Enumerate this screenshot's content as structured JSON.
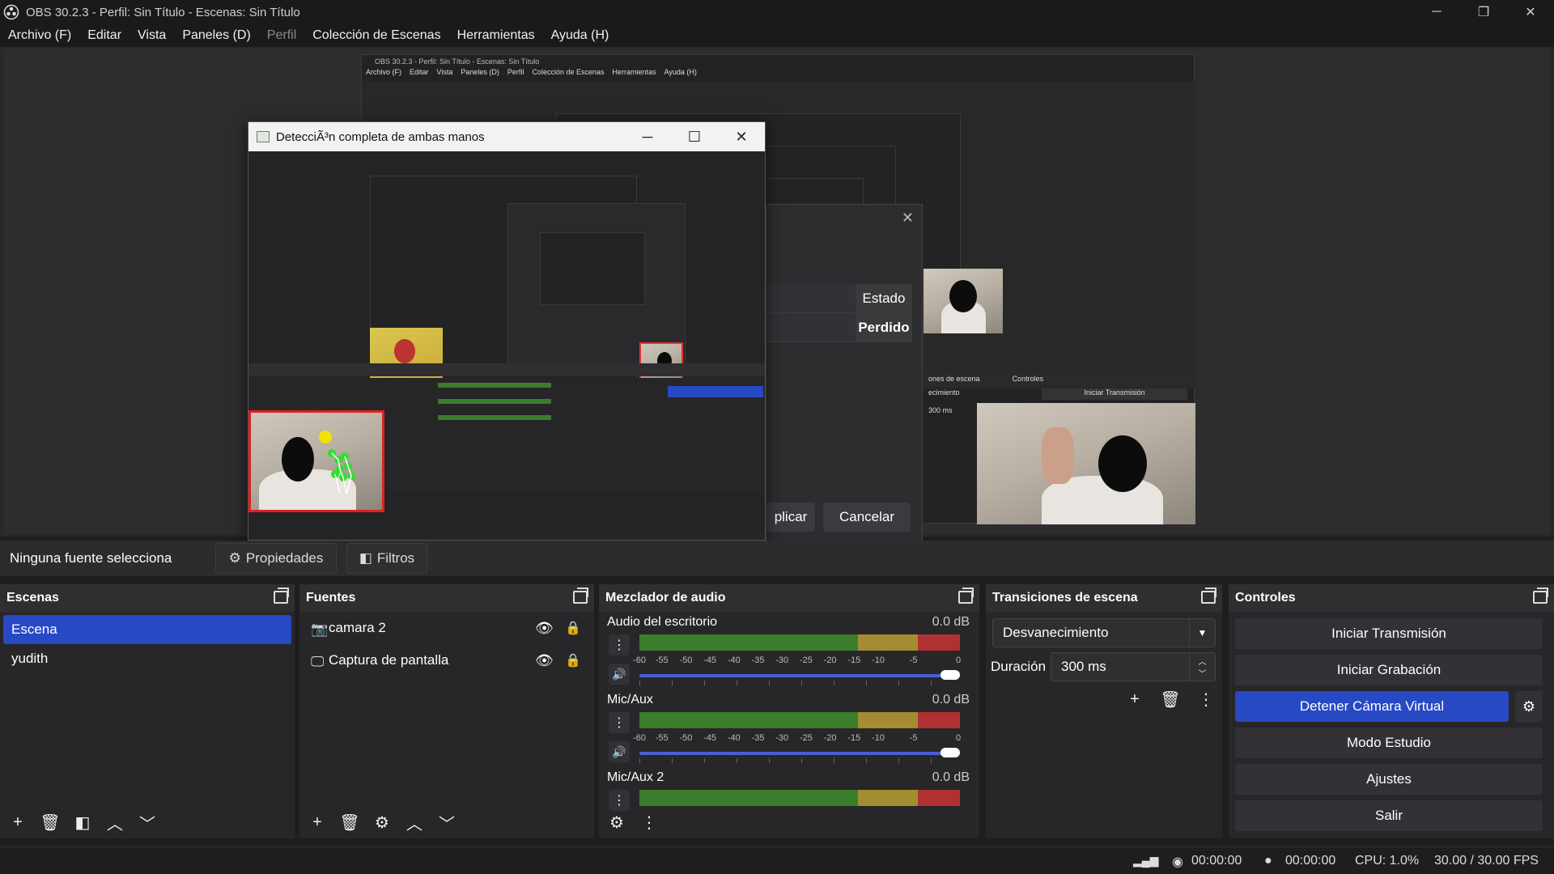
{
  "window": {
    "title": "OBS 30.2.3 - Perfil: Sin Título - Escenas: Sin Título",
    "minimize": "─",
    "restore": "❐",
    "close": "✕"
  },
  "menu": [
    {
      "label": "Archivo (F)",
      "disabled": false
    },
    {
      "label": "Editar",
      "disabled": false
    },
    {
      "label": "Vista",
      "disabled": false
    },
    {
      "label": "Paneles (D)",
      "disabled": false
    },
    {
      "label": "Perfil",
      "disabled": true
    },
    {
      "label": "Colección de Escenas",
      "disabled": false
    },
    {
      "label": "Herramientas",
      "disabled": false
    },
    {
      "label": "Ayuda (H)",
      "disabled": false
    }
  ],
  "nested": {
    "title": "OBS 30.2.3 - Perfil: Sin Título - Escenas: Sin Título",
    "menu": [
      "Archivo (F)",
      "Editar",
      "Vista",
      "Paneles (D)",
      "Perfil",
      "Colección de Escenas",
      "Herramientas",
      "Ayuda (H)"
    ],
    "dock_transitions": "ones de escena",
    "dock_controls": "Controles",
    "transition": "ecimiento",
    "duration": "300 ms",
    "start_stream": "Iniciar Transmisión"
  },
  "properties_dialog": {
    "col_header": "Estado",
    "status_value": "Perdido",
    "apply_label": "plicar",
    "cancel_label": "Cancelar"
  },
  "hand_window": {
    "title": "DetecciÃ³n completa de ambas manos"
  },
  "source_bar": {
    "no_source": "Ninguna fuente selecciona",
    "properties": "Propiedades",
    "filters": "Filtros"
  },
  "scenes": {
    "title": "Escenas",
    "items": [
      {
        "label": "Escena",
        "selected": true
      },
      {
        "label": "yudith",
        "selected": false
      }
    ]
  },
  "sources": {
    "title": "Fuentes",
    "items": [
      {
        "label": "camara 2",
        "icon": "camera-icon"
      },
      {
        "label": "Captura de pantalla",
        "icon": "monitor-icon"
      }
    ]
  },
  "mixer": {
    "title": "Mezclador de audio",
    "ticks": [
      "-60",
      "-55",
      "-50",
      "-45",
      "-40",
      "-35",
      "-30",
      "-25",
      "-20",
      "-15",
      "-10",
      "-5",
      "0"
    ],
    "channels": [
      {
        "name": "Audio del escritorio",
        "db": "0.0 dB",
        "volume": 1.0
      },
      {
        "name": "Mic/Aux",
        "db": "0.0 dB",
        "volume": 1.0
      },
      {
        "name": "Mic/Aux 2",
        "db": "0.0 dB",
        "volume": 1.0
      }
    ]
  },
  "transitions": {
    "title": "Transiciones de escena",
    "selected": "Desvanecimiento",
    "duration_label": "Duración",
    "duration_value": "300 ms"
  },
  "controls": {
    "title": "Controles",
    "buttons": [
      {
        "label": "Iniciar Transmisión",
        "active": false
      },
      {
        "label": "Iniciar Grabación",
        "active": false
      },
      {
        "label": "Detener Cámara Virtual",
        "active": true
      },
      {
        "label": "Modo Estudio",
        "active": false
      },
      {
        "label": "Ajustes",
        "active": false
      },
      {
        "label": "Salir",
        "active": false
      }
    ]
  },
  "status": {
    "stream_time": "00:00:00",
    "rec_time": "00:00:00",
    "cpu": "CPU: 1.0%",
    "fps": "30.00 / 30.00 FPS"
  },
  "colors": {
    "accent": "#2849c4",
    "meter_green": "#3b7d2c",
    "meter_yellow": "#a38c32",
    "meter_red": "#b03131",
    "background": "#1f1e1f"
  }
}
